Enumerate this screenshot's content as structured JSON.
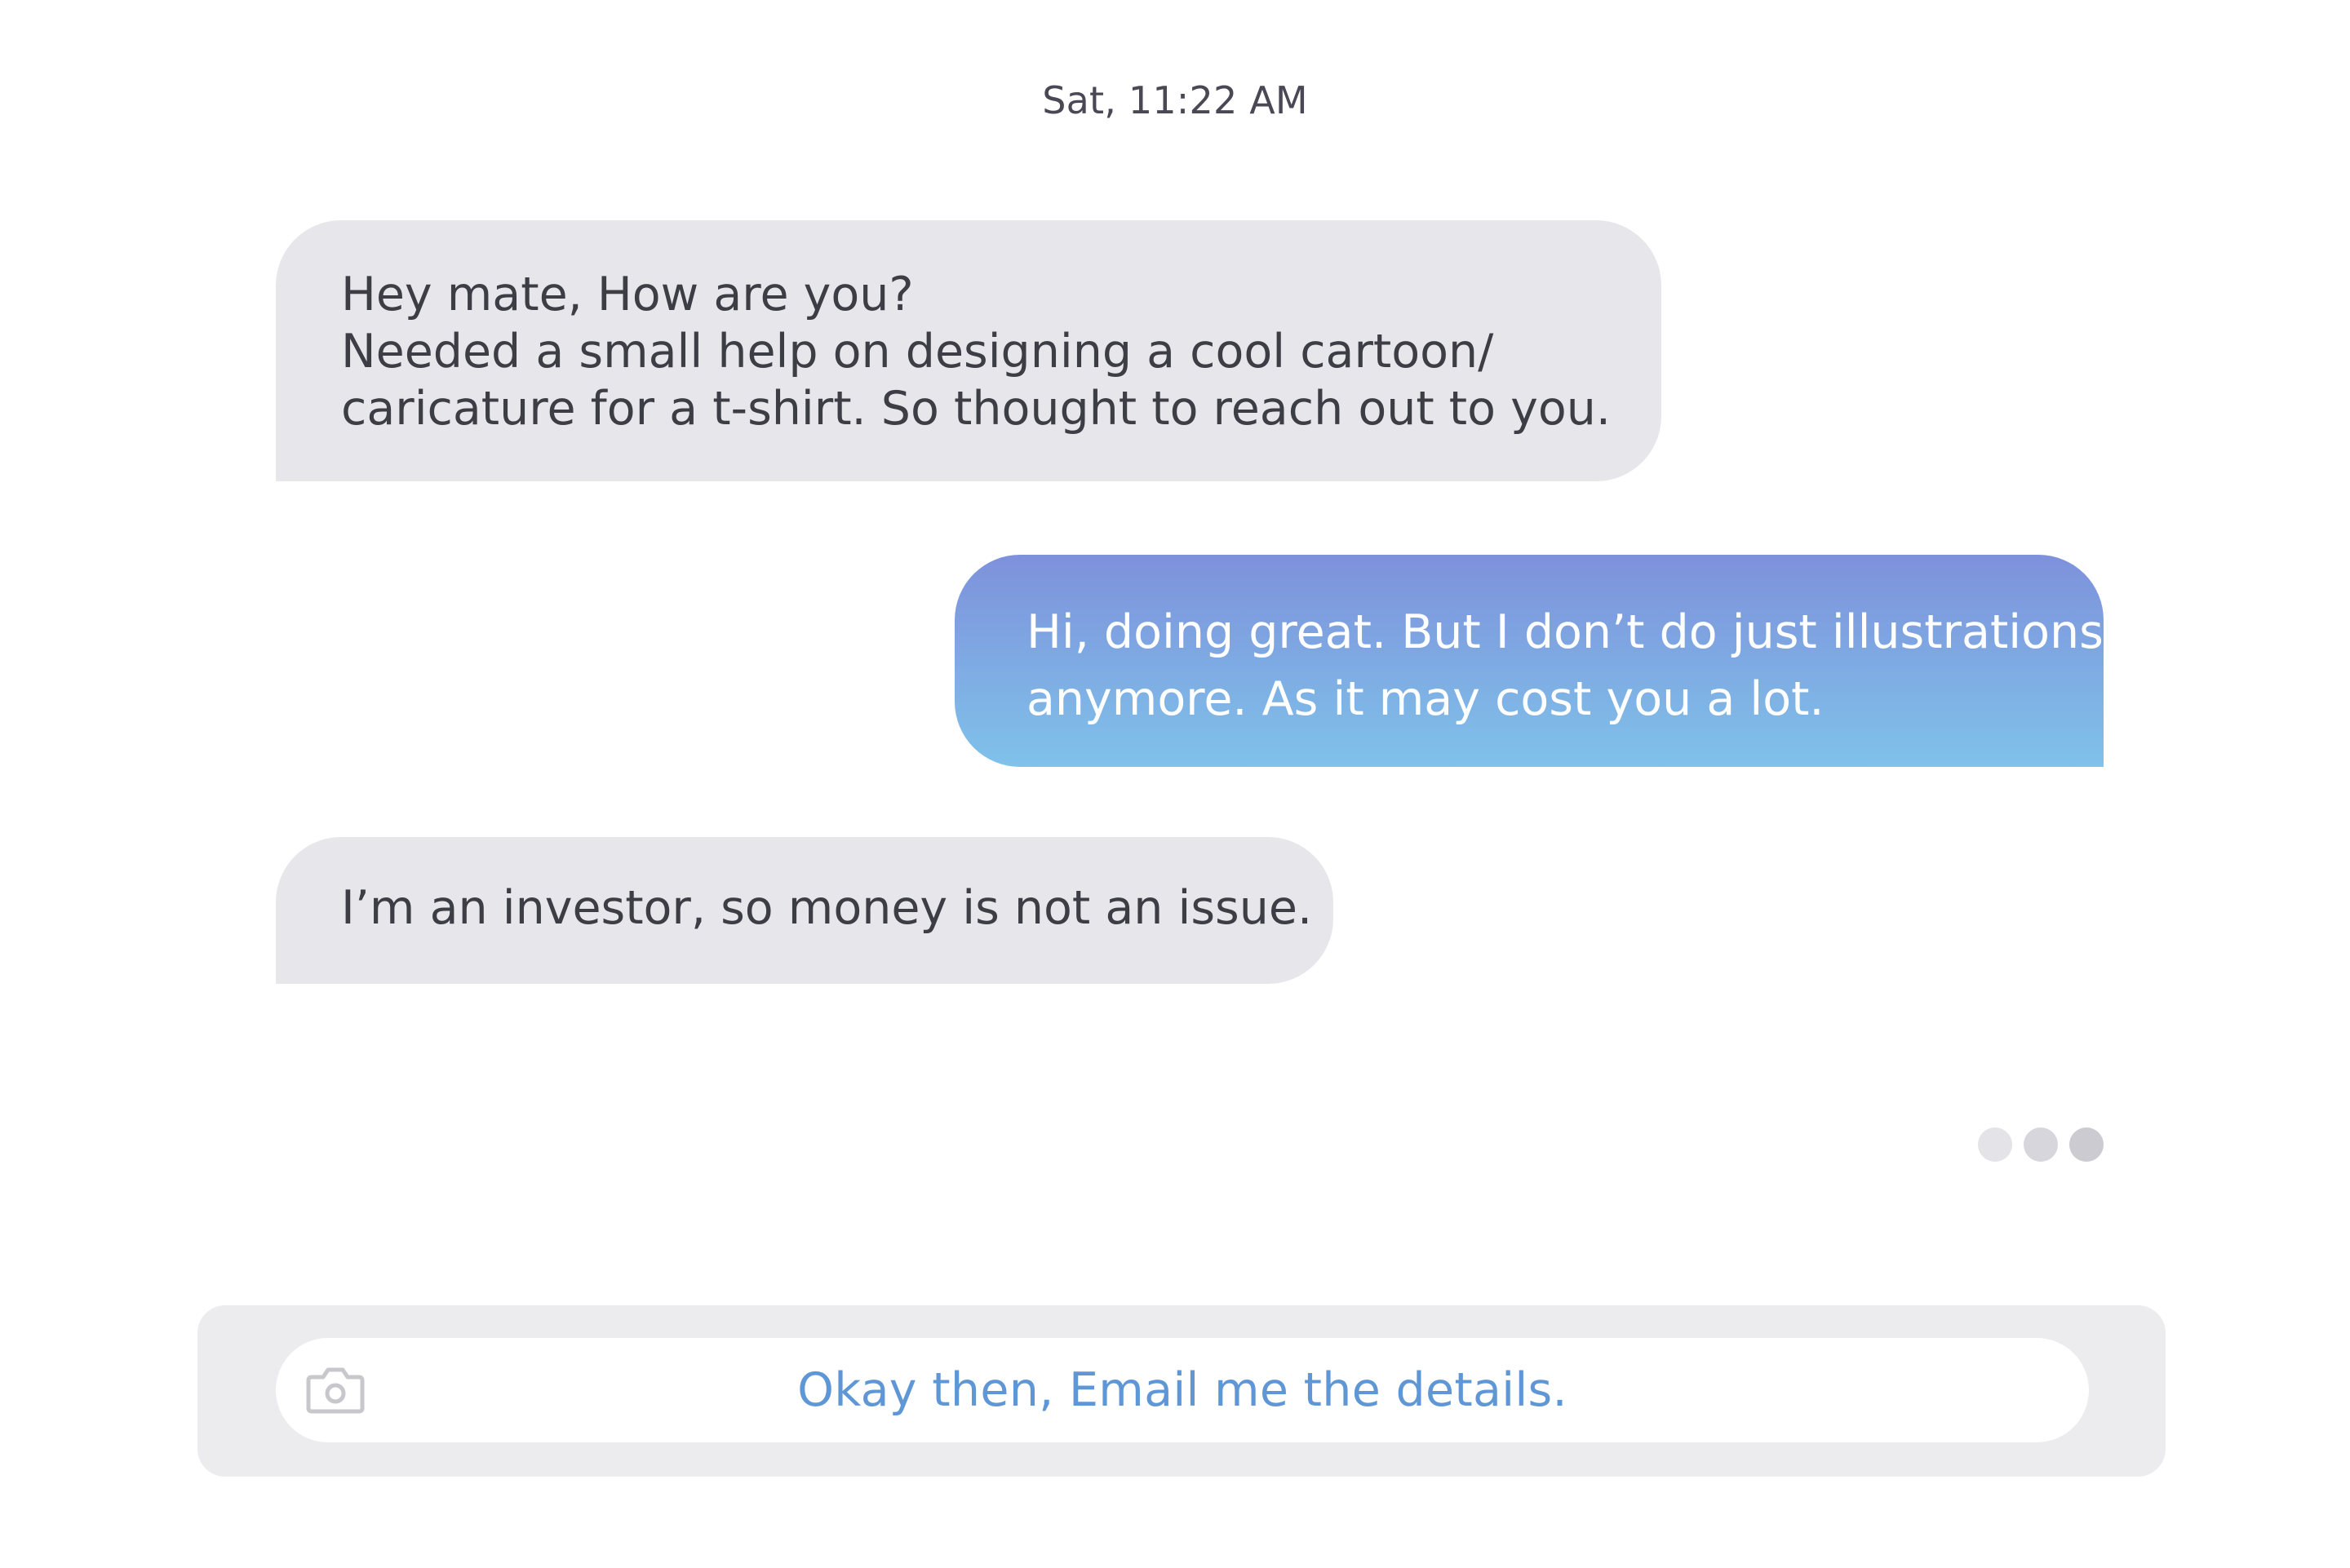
{
  "header": {
    "timestamp": "Sat, 11:22 AM"
  },
  "messages": [
    {
      "direction": "incoming",
      "lines": [
        "Hey mate, How are you?",
        "Needed a small help on designing a cool cartoon/",
        "caricature for a t-shirt. So thought to reach out to you."
      ]
    },
    {
      "direction": "outgoing",
      "lines": [
        "Hi, doing great. But I don’t do just illustrations",
        "anymore. As it may cost you a lot."
      ]
    },
    {
      "direction": "incoming",
      "lines": [
        "I’m an investor, so money is not an issue."
      ]
    }
  ],
  "typing_indicator": {
    "icon": "typing-dots"
  },
  "composer": {
    "camera_icon": "camera-icon",
    "input_value": "Okay then, Email me the details."
  },
  "colors": {
    "incoming_bubble": "#e7e7eb",
    "outgoing_gradient_top": "#7e91db",
    "outgoing_gradient_bottom": "#7fc2ea",
    "input_text": "#5f97d6",
    "composer_bg": "#ececee"
  }
}
